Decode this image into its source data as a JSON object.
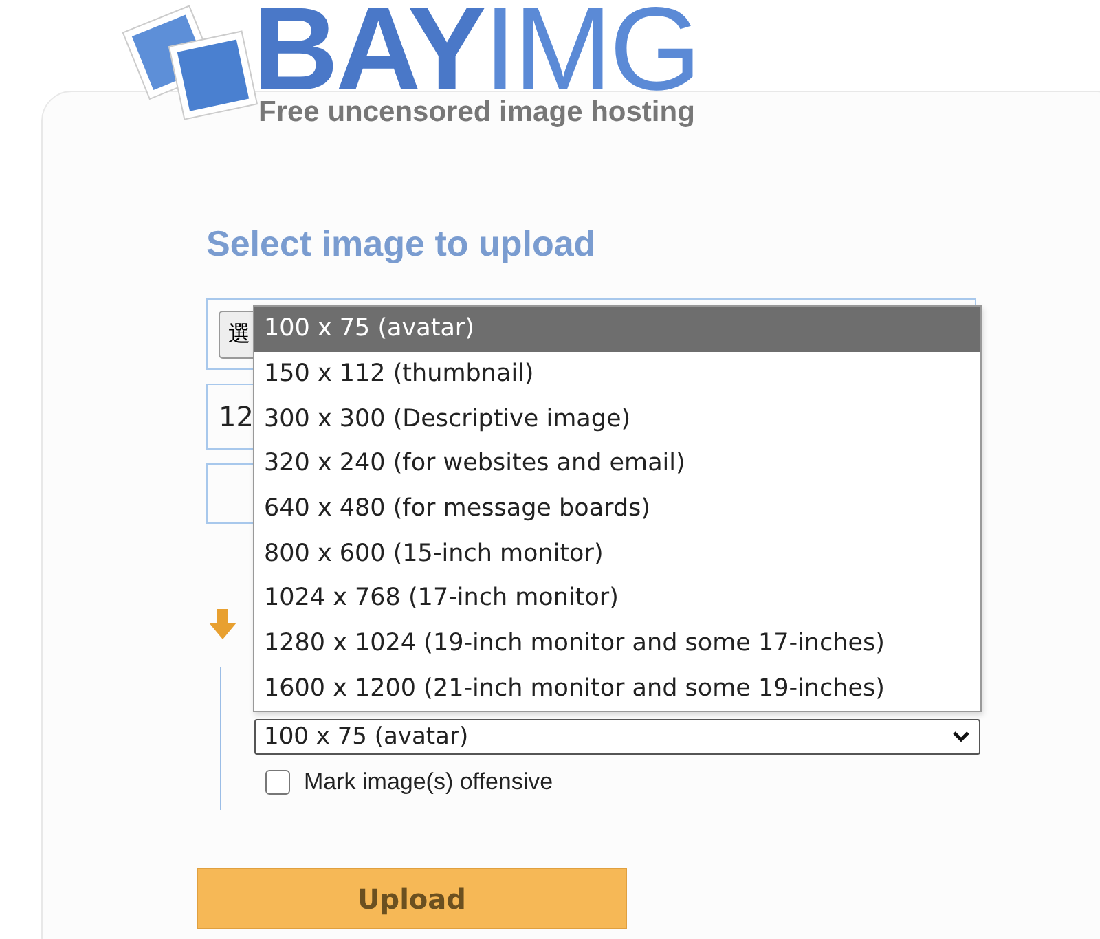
{
  "logo": {
    "bold": "BAY",
    "light": "IMG",
    "tagline": "Free uncensored image hosting"
  },
  "heading": "Select image to upload",
  "file_button": "選",
  "field_value": "12",
  "size_select": {
    "value": "100 x 75 (avatar)",
    "expanded": true,
    "options": [
      {
        "label": "100 x 75 (avatar)",
        "selected": true
      },
      {
        "label": "150 x 112 (thumbnail)",
        "selected": false
      },
      {
        "label": "300 x 300 (Descriptive image)",
        "selected": false
      },
      {
        "label": "320 x 240 (for websites and email)",
        "selected": false
      },
      {
        "label": "640 x 480 (for message boards)",
        "selected": false
      },
      {
        "label": "800 x 600 (15-inch monitor)",
        "selected": false
      },
      {
        "label": "1024 x 768 (17-inch monitor)",
        "selected": false
      },
      {
        "label": "1280 x 1024 (19-inch monitor and some 17-inches)",
        "selected": false
      },
      {
        "label": "1600 x 1200 (21-inch monitor and some 19-inches)",
        "selected": false
      }
    ]
  },
  "offensive": {
    "label": "Mark image(s) offensive",
    "checked": false
  },
  "upload": "Upload"
}
